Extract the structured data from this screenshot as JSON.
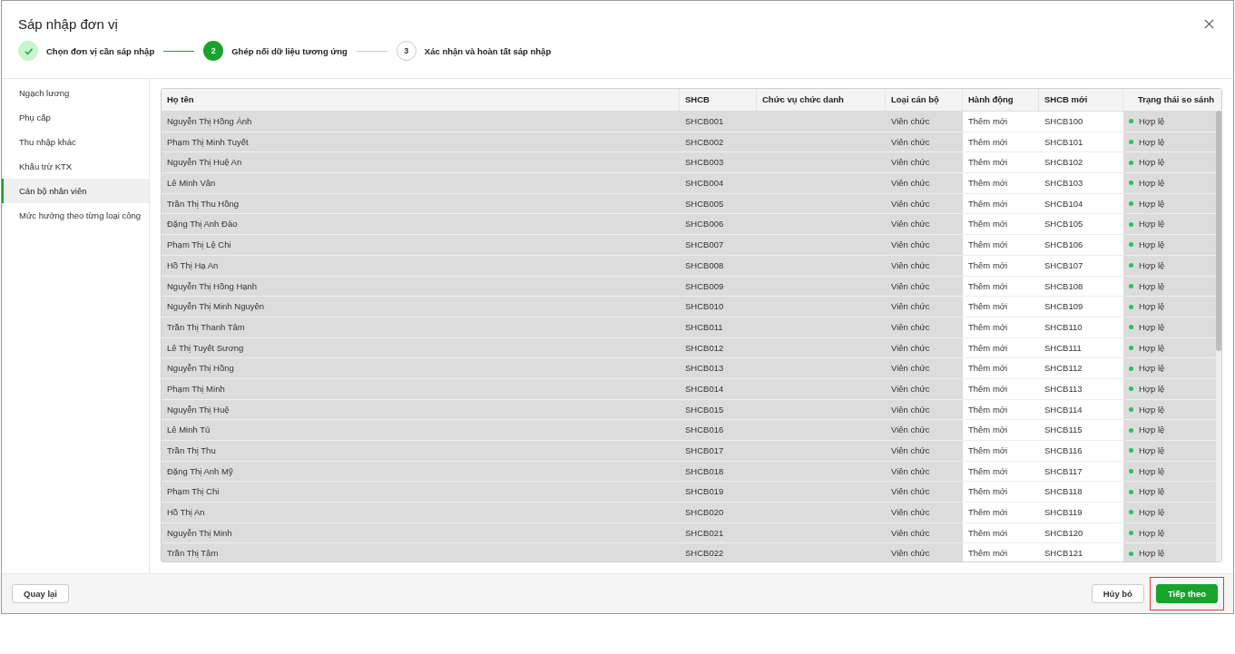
{
  "window": {
    "title": "Sáp nhập đơn vị"
  },
  "steps": [
    {
      "label": "Chọn đơn vị cần sáp nhập",
      "completed": true,
      "current": false
    },
    {
      "number": "2",
      "label": "Ghép nối dữ liệu tương ứng",
      "completed": false,
      "current": true
    },
    {
      "number": "3",
      "label": "Xác nhận và hoàn tất sáp nhập",
      "completed": false,
      "current": false
    }
  ],
  "sidebar": {
    "items": [
      {
        "label": "Ngạch lương",
        "selected": false
      },
      {
        "label": "Phụ cấp",
        "selected": false
      },
      {
        "label": "Thu nhập khác",
        "selected": false
      },
      {
        "label": "Khấu trừ KTX",
        "selected": false
      },
      {
        "label": "Cán bộ nhân viên",
        "selected": true
      },
      {
        "label": "Mức hưởng theo từng loại công",
        "selected": false
      }
    ]
  },
  "table": {
    "columns": [
      "Họ tên",
      "SHCB",
      "Chức vụ chức danh",
      "Loại cán bộ",
      "Hành động",
      "SHCB mới",
      "Trạng thái so sánh"
    ],
    "rows": [
      {
        "name": "Nguyễn Thị Hồng Ánh",
        "shcb": "SHCB001",
        "type": "Viên chức",
        "action": "Thêm mới",
        "new_shcb": "SHCB100",
        "status": "Hợp lệ",
        "color": "#22c55e"
      },
      {
        "name": "Phạm Thị Minh Tuyết",
        "shcb": "SHCB002",
        "type": "Viên chức",
        "action": "Thêm mới",
        "new_shcb": "SHCB101",
        "status": "Hợp lệ",
        "color": "#22c55e"
      },
      {
        "name": "Nguyễn Thị Huệ An",
        "shcb": "SHCB003",
        "type": "Viên chức",
        "action": "Thêm mới",
        "new_shcb": "SHCB102",
        "status": "Hợp lệ",
        "color": "#22c55e"
      },
      {
        "name": "Lê Minh Vân",
        "shcb": "SHCB004",
        "type": "Viên chức",
        "action": "Thêm mới",
        "new_shcb": "SHCB103",
        "status": "Hợp lệ",
        "color": "#22c55e"
      },
      {
        "name": "Trần Thị Thu Hồng",
        "shcb": "SHCB005",
        "type": "Viên chức",
        "action": "Thêm mới",
        "new_shcb": "SHCB104",
        "status": "Hợp lệ",
        "color": "#22c55e"
      },
      {
        "name": "Đặng Thị Anh Đào",
        "shcb": "SHCB006",
        "type": "Viên chức",
        "action": "Thêm mới",
        "new_shcb": "SHCB105",
        "status": "Hợp lệ",
        "color": "#22c55e"
      },
      {
        "name": "Phạm Thị Lệ Chi",
        "shcb": "SHCB007",
        "type": "Viên chức",
        "action": "Thêm mới",
        "new_shcb": "SHCB106",
        "status": "Hợp lệ",
        "color": "#22c55e"
      },
      {
        "name": "Hồ Thị Hạ An",
        "shcb": "SHCB008",
        "type": "Viên chức",
        "action": "Thêm mới",
        "new_shcb": "SHCB107",
        "status": "Hợp lệ",
        "color": "#22c55e"
      },
      {
        "name": "Nguyễn Thị Hồng Hạnh",
        "shcb": "SHCB009",
        "type": "Viên chức",
        "action": "Thêm mới",
        "new_shcb": "SHCB108",
        "status": "Hợp lệ",
        "color": "#22c55e"
      },
      {
        "name": "Nguyễn Thị Minh Nguyên",
        "shcb": "SHCB010",
        "type": "Viên chức",
        "action": "Thêm mới",
        "new_shcb": "SHCB109",
        "status": "Hợp lệ",
        "color": "#22c55e"
      },
      {
        "name": "Trần Thị Thanh Tâm",
        "shcb": "SHCB011",
        "type": "Viên chức",
        "action": "Thêm mới",
        "new_shcb": "SHCB110",
        "status": "Hợp lệ",
        "color": "#22c55e"
      },
      {
        "name": "Lê Thị Tuyết Sương",
        "shcb": "SHCB012",
        "type": "Viên chức",
        "action": "Thêm mới",
        "new_shcb": "SHCB111",
        "status": "Hợp lệ",
        "color": "#22c55e"
      },
      {
        "name": "Nguyễn Thị Hồng",
        "shcb": "SHCB013",
        "type": "Viên chức",
        "action": "Thêm mới",
        "new_shcb": "SHCB112",
        "status": "Hợp lệ",
        "color": "#22c55e"
      },
      {
        "name": "Phạm Thị Minh",
        "shcb": "SHCB014",
        "type": "Viên chức",
        "action": "Thêm mới",
        "new_shcb": "SHCB113",
        "status": "Hợp lệ",
        "color": "#22c55e"
      },
      {
        "name": "Nguyễn Thị Huệ",
        "shcb": "SHCB015",
        "type": "Viên chức",
        "action": "Thêm mới",
        "new_shcb": "SHCB114",
        "status": "Hợp lệ",
        "color": "#22c55e"
      },
      {
        "name": "Lê Minh Tú",
        "shcb": "SHCB016",
        "type": "Viên chức",
        "action": "Thêm mới",
        "new_shcb": "SHCB115",
        "status": "Hợp lệ",
        "color": "#22c55e"
      },
      {
        "name": "Trần Thị Thu",
        "shcb": "SHCB017",
        "type": "Viên chức",
        "action": "Thêm mới",
        "new_shcb": "SHCB116",
        "status": "Hợp lệ",
        "color": "#22c55e"
      },
      {
        "name": "Đặng Thị Anh Mỹ",
        "shcb": "SHCB018",
        "type": "Viên chức",
        "action": "Thêm mới",
        "new_shcb": "SHCB117",
        "status": "Hợp lệ",
        "color": "#22c55e"
      },
      {
        "name": "Phạm Thị Chi",
        "shcb": "SHCB019",
        "type": "Viên chức",
        "action": "Thêm mới",
        "new_shcb": "SHCB118",
        "status": "Hợp lệ",
        "color": "#22c55e"
      },
      {
        "name": "Hồ Thị An",
        "shcb": "SHCB020",
        "type": "Viên chức",
        "action": "Thêm mới",
        "new_shcb": "SHCB119",
        "status": "Hợp lệ",
        "color": "#22c55e"
      },
      {
        "name": "Nguyễn Thị Minh",
        "shcb": "SHCB021",
        "type": "Viên chức",
        "action": "Thêm mới",
        "new_shcb": "SHCB120",
        "status": "Hợp lệ",
        "color": "#22c55e"
      },
      {
        "name": "Trần Thị Tâm",
        "shcb": "SHCB022",
        "type": "Viên chức",
        "action": "Thêm mới",
        "new_shcb": "SHCB121",
        "status": "Hợp lệ",
        "color": "#22c55e"
      }
    ]
  },
  "footer": {
    "back": "Quay lại",
    "cancel": "Hủy bỏ",
    "next": {
      "label": "Tiếp theo",
      "highlighted": true
    }
  }
}
